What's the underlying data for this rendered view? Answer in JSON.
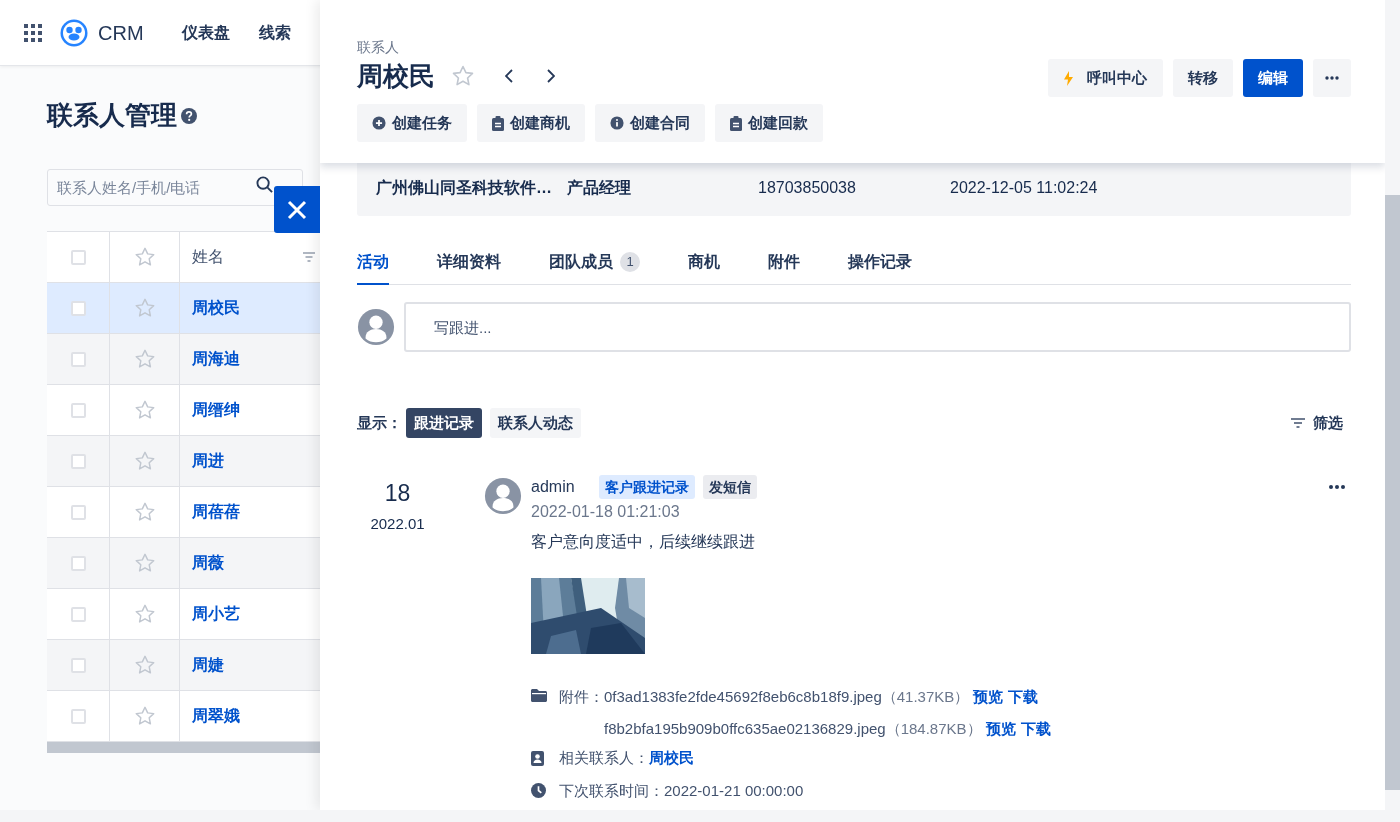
{
  "nav": {
    "brand": "CRM",
    "items": [
      {
        "label": "仪表盘",
        "selected": false
      },
      {
        "label": "线索",
        "selected": false
      }
    ]
  },
  "page": {
    "title": "联系人管理",
    "search": {
      "placeholder": "联系人姓名/手机/电话"
    },
    "table": {
      "columns": [
        "姓名"
      ],
      "all_checked": false,
      "rows": [
        {
          "name": "周校民",
          "selected": true,
          "checked": false,
          "starred": false
        },
        {
          "name": "周海迪",
          "selected": false,
          "checked": false,
          "starred": false
        },
        {
          "name": "周缙绅",
          "selected": false,
          "checked": false,
          "starred": false
        },
        {
          "name": "周进",
          "selected": false,
          "checked": false,
          "starred": false
        },
        {
          "name": "周蓓蓓",
          "selected": false,
          "checked": false,
          "starred": false
        },
        {
          "name": "周薇",
          "selected": false,
          "checked": false,
          "starred": false
        },
        {
          "name": "周小艺",
          "selected": false,
          "checked": false,
          "starred": false
        },
        {
          "name": "周婕",
          "selected": false,
          "checked": false,
          "starred": false
        },
        {
          "name": "周翠娥",
          "selected": false,
          "checked": false,
          "starred": false
        }
      ]
    }
  },
  "drawer": {
    "kicker": "联系人",
    "name": "周校民",
    "starred": false,
    "actions": [
      {
        "label": "呼叫中心",
        "kind": "call"
      },
      {
        "label": "转移",
        "kind": "plain"
      },
      {
        "label": "编辑",
        "kind": "primary"
      },
      {
        "kind": "more"
      }
    ],
    "quick_actions": [
      {
        "label": "创建任务",
        "kind": "task"
      },
      {
        "label": "创建商机",
        "kind": "opportunity"
      },
      {
        "label": "创建合同",
        "kind": "contract"
      },
      {
        "label": "创建回款",
        "kind": "payment"
      }
    ],
    "summary": [
      "广州佛山同圣科技软件…",
      "产品经理",
      "18703850038",
      "2022-12-05 11:02:24"
    ],
    "tabs": [
      {
        "label": "活动",
        "selected": true
      },
      {
        "label": "详细资料",
        "selected": false
      },
      {
        "label": "团队成员",
        "selected": false,
        "count": "1"
      },
      {
        "label": "商机",
        "selected": false
      },
      {
        "label": "附件",
        "selected": false
      },
      {
        "label": "操作记录",
        "selected": false
      }
    ],
    "composer": {
      "placeholder": "写跟进..."
    },
    "filter": {
      "label": "显示：",
      "options": [
        {
          "label": "跟进记录",
          "selected": true
        },
        {
          "label": "联系人动态",
          "selected": false
        }
      ],
      "button": "筛选"
    },
    "entries": [
      {
        "day": "18",
        "month": "2022.01",
        "author": "admin",
        "tags": [
          {
            "label": "客户跟进记录",
            "kind": "type"
          },
          {
            "label": "发短信",
            "kind": "method"
          }
        ],
        "time": "2022-01-18 01:21:03",
        "content": "客户意向度适中，后续继续跟进",
        "attachments_label": "附件：",
        "attachments": [
          {
            "file": "0f3ad1383fe2fde45692f8eb6c8b18f9.jpeg",
            "size": "（41.37KB）",
            "actions": [
              "预览",
              "下载"
            ]
          },
          {
            "file": "f8b2bfa195b909b0ffc635ae02136829.jpeg",
            "size": "（184.87KB）",
            "actions": [
              "预览",
              "下载"
            ]
          }
        ],
        "contact_label": "相关联系人：",
        "contact": "周校民",
        "next_label": "下次联系时间：",
        "next_time": "2022-01-21 00:00:00"
      }
    ]
  }
}
